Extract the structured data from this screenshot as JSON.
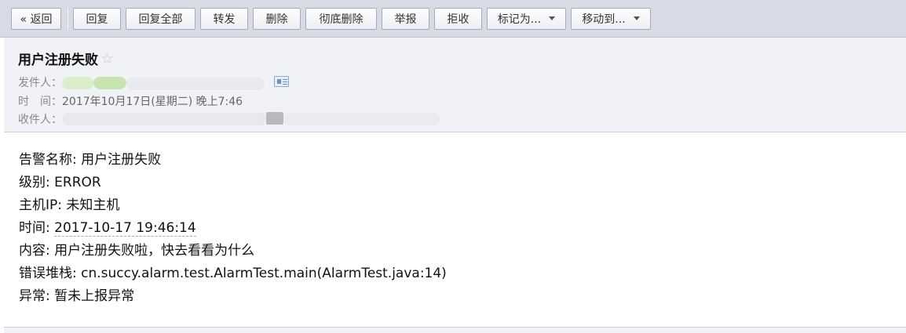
{
  "toolbar": {
    "back": "« 返回",
    "reply": "回复",
    "reply_all": "回复全部",
    "forward": "转发",
    "delete": "删除",
    "delete_forever": "彻底删除",
    "report": "举报",
    "reject": "拒收",
    "mark_as": "标记为...",
    "move_to": "移动到..."
  },
  "email": {
    "subject": "用户注册失败",
    "star": "☆",
    "from_label": "发件人：",
    "time_label": "时　间：",
    "time_value": "2017年10月17日(星期二) 晚上7:46",
    "to_label": "收件人："
  },
  "content": {
    "alert_name_label": "告警名称: ",
    "alert_name_value": "用户注册失败",
    "level_label": "级别: ",
    "level_value": "ERROR",
    "host_label": "主机IP: ",
    "host_value": "未知主机",
    "time_label": "时间: ",
    "time_value": "2017-10-17 19:46:14",
    "message_label": "内容: ",
    "message_value": "用户注册失败啦，快去看看为什么",
    "stack_label": "错误堆栈: ",
    "stack_value": "cn.succy.alarm.test.AlarmTest.main(AlarmTest.java:14)",
    "exception_label": "异常: ",
    "exception_value": "暂未上报异常"
  }
}
